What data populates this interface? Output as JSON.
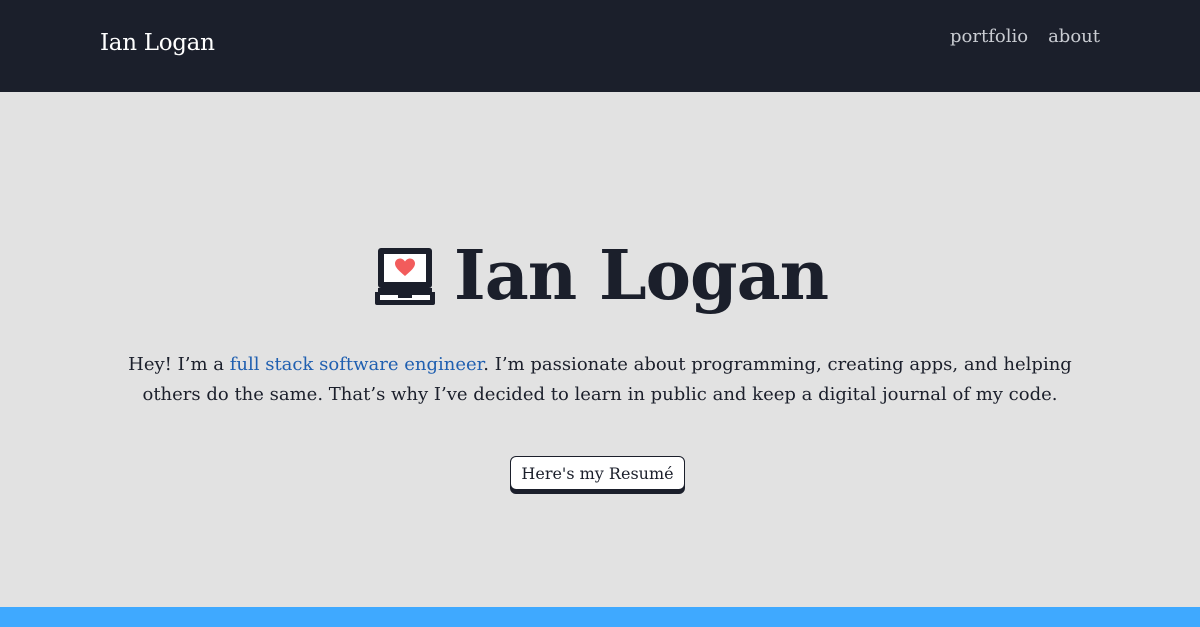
{
  "navbar": {
    "brand": "Ian Logan",
    "links": [
      {
        "label": "portfolio"
      },
      {
        "label": "about"
      }
    ]
  },
  "hero": {
    "icon": "laptop-heart-icon",
    "title": "Ian Logan",
    "intro_before": "Hey! I’m a ",
    "intro_link": "full stack software engineer",
    "intro_after": ". I’m passionate about programming, creating apps, and helping others do the same. That’s why I’ve decided to learn in public and keep a digital journal of my code.",
    "button_label": "Here's my Resumé"
  },
  "colors": {
    "navbar_bg": "#1b1f2b",
    "hero_bg": "#e2e2e2",
    "link": "#1f5fb0",
    "heart": "#f25c5c",
    "footer_strip": "#3fa9ff"
  }
}
